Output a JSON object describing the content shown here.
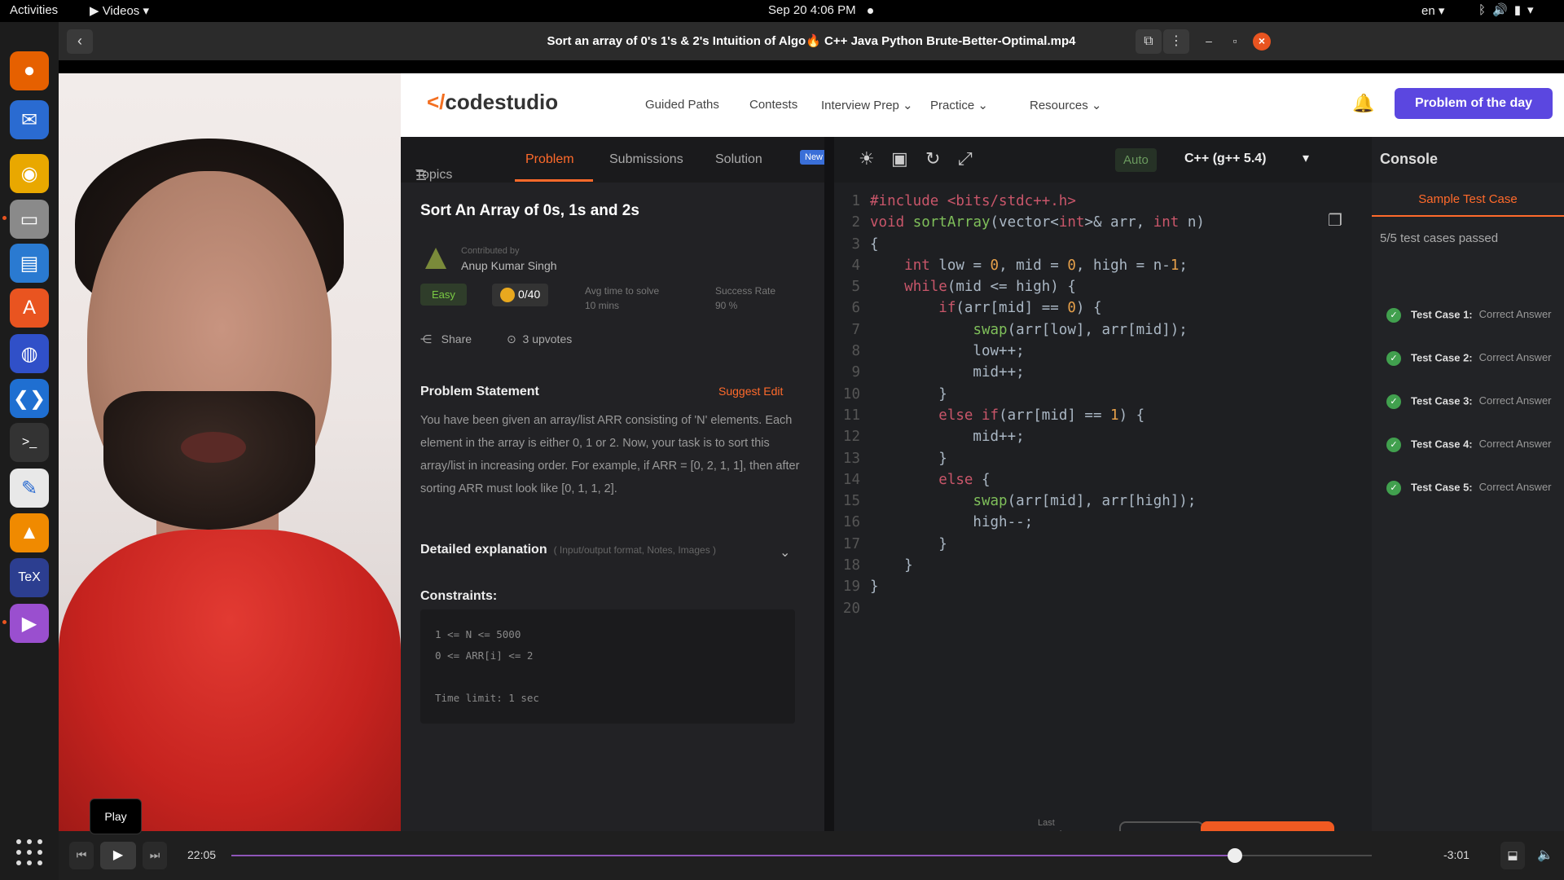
{
  "topbar": {
    "activities": "Activities",
    "app_menu": "Videos",
    "clock": "Sep 20  4:06 PM",
    "language": "en"
  },
  "dock": {
    "apps": [
      {
        "name": "firefox-icon",
        "glyph": "●",
        "color": "#e66000"
      },
      {
        "name": "thunderbird-icon",
        "glyph": "✉",
        "color": "#2a6bd1"
      },
      {
        "name": "rhythmbox-icon",
        "glyph": "◉",
        "color": "#e9a800"
      },
      {
        "name": "files-icon",
        "glyph": "▭",
        "color": "#8a8a8a"
      },
      {
        "name": "writer-icon",
        "glyph": "▤",
        "color": "#2a7ad1"
      },
      {
        "name": "software-icon",
        "glyph": "A",
        "color": "#e95420"
      },
      {
        "name": "app-icon-7",
        "glyph": "◍",
        "color": "#3050c8"
      },
      {
        "name": "vscode-icon",
        "glyph": "❮❯",
        "color": "#1f6fd1"
      },
      {
        "name": "terminal-icon",
        "glyph": ">_",
        "color": "#333333"
      },
      {
        "name": "text-editor-icon",
        "glyph": "✎",
        "color": "#e8e8e8"
      },
      {
        "name": "vlc-icon",
        "glyph": "▲",
        "color": "#f08a00"
      },
      {
        "name": "tex-icon",
        "glyph": "TeX",
        "color": "#2c3e90"
      },
      {
        "name": "videos-icon",
        "glyph": "▶",
        "color": "#9a4fcf"
      }
    ]
  },
  "window": {
    "title": "Sort an array of 0's 1's & 2's Intuition of Algo🔥 C++ Java Python Brute-Better-Optimal.mp4"
  },
  "codestudio": {
    "logo": "codestudio",
    "menu": [
      "Guided Paths",
      "Contests",
      "Interview Prep",
      "Practice",
      "Resources"
    ],
    "potd_button": "Problem of the day",
    "tabs": [
      "Topics",
      "Problem",
      "Submissions",
      "Solution"
    ],
    "tab_new_badge": "New",
    "problem_title": "Sort An Array of 0s, 1s and 2s",
    "contributed_by": "Contributed by",
    "author": "Anup Kumar Singh",
    "difficulty": "Easy",
    "coins": "0/40",
    "avg_time_label": "Avg time to solve",
    "avg_time_value": "10 mins",
    "success_label": "Success Rate",
    "success_value": "90 %",
    "share": "Share",
    "upvotes": "3 upvotes",
    "statement_heading": "Problem Statement",
    "suggest_edit": "Suggest Edit",
    "statement": "You have been given an array/list ARR consisting of 'N' elements. Each element in the array is either 0, 1 or 2. Now, your task is to sort this array/list in increasing order. For example, if ARR = [0, 2, 1, 1], then after sorting ARR must look like [0, 1, 1, 2].",
    "detailed_heading": "Detailed explanation",
    "detailed_sub": "( Input/output format, Notes, Images )",
    "constraints_heading": "Constraints:",
    "constraints": [
      "1 <= N <= 5000",
      "0 <= ARR[i] <= 2",
      "",
      "Time limit: 1 sec"
    ],
    "editor_auto": "Auto",
    "editor_lang": "C++ (g++ 5.4)",
    "last_saved": "Last saved",
    "console_title": "Console",
    "console_tab": "Sample Test Case",
    "console_passed": "5/5 test cases passed",
    "test_cases": [
      {
        "label": "Test Case 1:",
        "result": "Correct Answer"
      },
      {
        "label": "Test Case 2:",
        "result": "Correct Answer"
      },
      {
        "label": "Test Case 3:",
        "result": "Correct Answer"
      },
      {
        "label": "Test Case 4:",
        "result": "Correct Answer"
      },
      {
        "label": "Test Case 5:",
        "result": "Correct Answer"
      }
    ]
  },
  "code_lines": [
    "#include <bits/stdc++.h>",
    "void sortArray(vector<int>& arr, int n)",
    "{",
    "    int low = 0, mid = 0, high = n-1;",
    "    while(mid <= high) {",
    "        if(arr[mid] == 0) {",
    "            swap(arr[low], arr[mid]);",
    "            low++;",
    "            mid++;",
    "        }",
    "        else if(arr[mid] == 1) {",
    "            mid++;",
    "        }",
    "        else {",
    "            swap(arr[mid], arr[high]);",
    "            high--;",
    "        }",
    "    }",
    "}",
    ""
  ],
  "player": {
    "elapsed": "22:05",
    "remaining": "-3:01",
    "progress": 0.88,
    "tooltip": "Play"
  }
}
